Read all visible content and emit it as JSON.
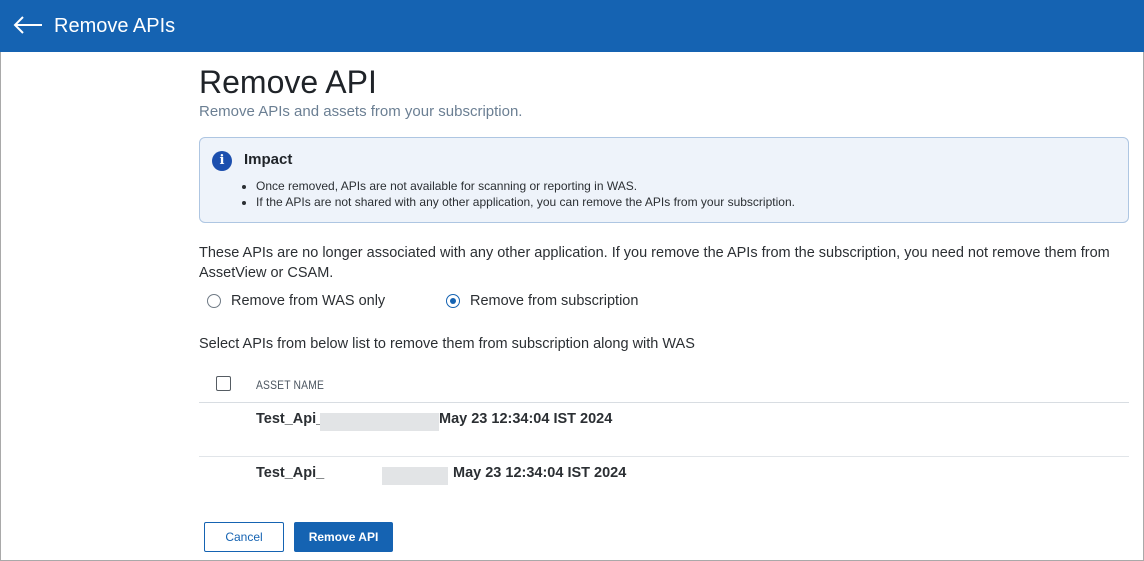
{
  "header": {
    "back_icon": "arrow-left-icon",
    "title": "Remove APIs"
  },
  "page": {
    "title": "Remove API",
    "subtitle": "Remove APIs and assets from your subscription."
  },
  "impact": {
    "icon": "info-icon",
    "icon_glyph": "i",
    "title": "Impact",
    "items": [
      "Once removed, APIs are not available for scanning or reporting in WAS.",
      "If the APIs are not shared with any other application, you can remove the APIs from your subscription."
    ]
  },
  "description": "These APIs are no longer associated with any other application. If you remove the APIs from the subscription, you need not remove them from AssetView or CSAM.",
  "options": [
    {
      "label": "Remove from WAS only",
      "checked": false
    },
    {
      "label": "Remove from subscription",
      "checked": true
    }
  ],
  "select_hint": "Select APIs from below list to remove them from subscription along with WAS",
  "table": {
    "select_all_checked": false,
    "column_header": "ASSET NAME",
    "rows": [
      {
        "name_prefix": "Test_Api_",
        "date": "May 23 12:34:04 IST 2024"
      },
      {
        "name_prefix": "Test_Api_",
        "date": "May 23 12:34:04 IST 2024"
      }
    ]
  },
  "buttons": {
    "cancel": "Cancel",
    "remove": "Remove API"
  },
  "colors": {
    "primary": "#1563b2",
    "info_bg": "#eef3fa",
    "info_border": "#aec6e2",
    "redaction": "#e2e4e6"
  }
}
